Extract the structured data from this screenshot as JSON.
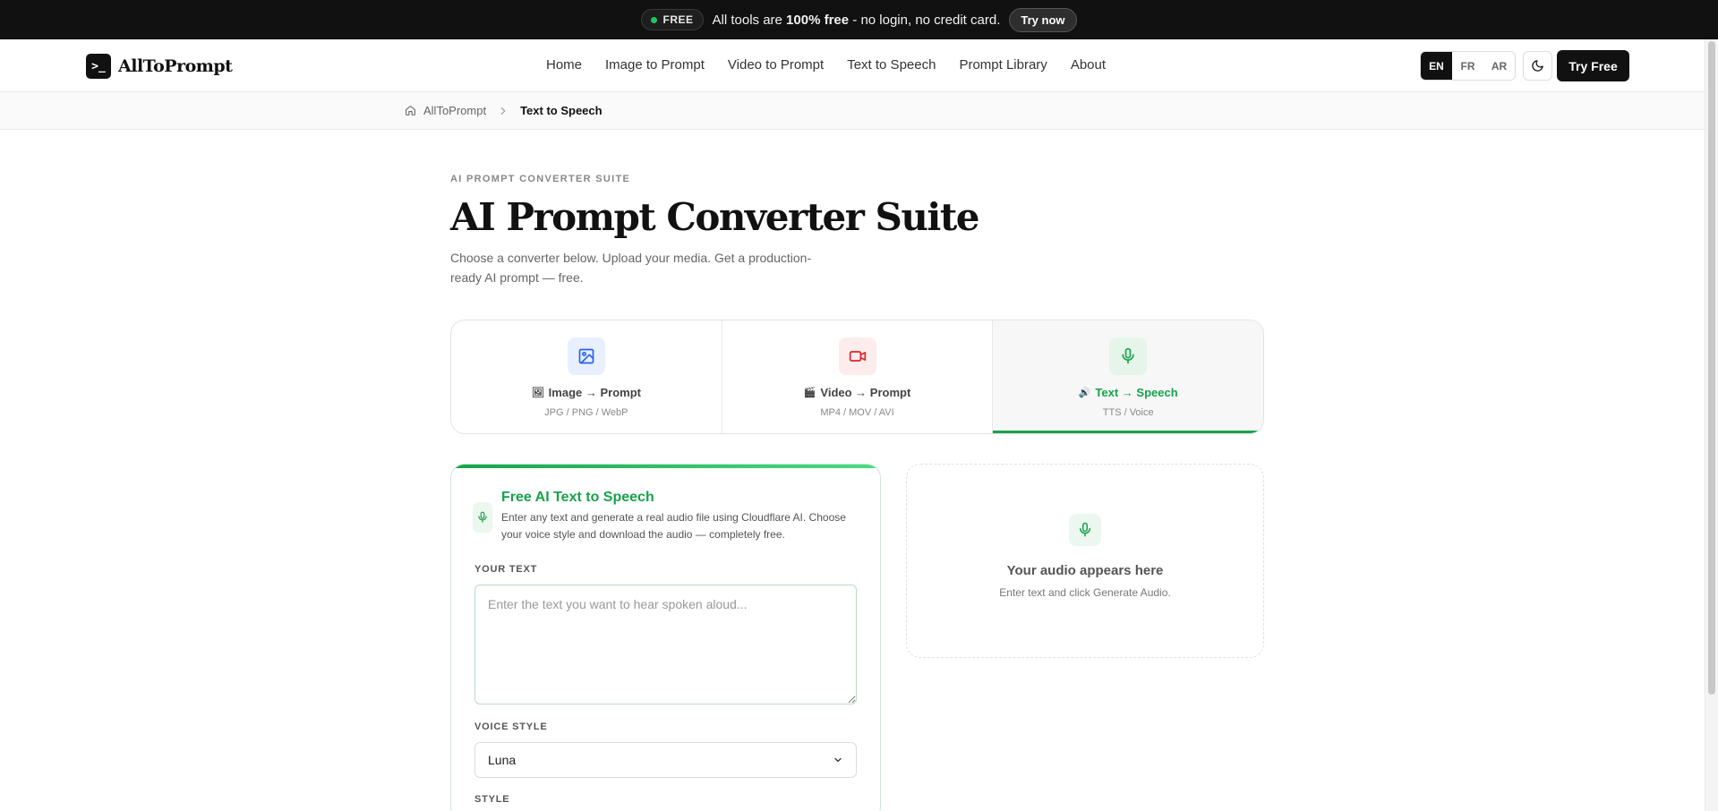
{
  "announcement": {
    "badge": "FREE",
    "text_prefix": "All tools are ",
    "text_bold": "100% free",
    "text_suffix": " - no login, no credit card.",
    "cta": "Try now"
  },
  "header": {
    "logo_mark": ">_",
    "logo_text": "AllToPrompt",
    "nav": [
      "Home",
      "Image to Prompt",
      "Video to Prompt",
      "Text to Speech",
      "Prompt Library",
      "About"
    ],
    "languages": [
      "EN",
      "FR",
      "AR"
    ],
    "active_language": "EN",
    "theme_icon": "moon-icon",
    "cta": "Try Free"
  },
  "breadcrumb": {
    "home": "AllToPrompt",
    "current": "Text to Speech"
  },
  "hero": {
    "eyebrow": "AI PROMPT CONVERTER SUITE",
    "title": "AI Prompt Converter Suite",
    "description": "Choose a converter below. Upload your media. Get a production-ready AI prompt — free."
  },
  "tabs": [
    {
      "glyph": "🖼",
      "label": "Image → Prompt",
      "sub": "JPG / PNG / WebP",
      "icon": "image-icon",
      "color": "#2563eb",
      "bg": "#e8efff"
    },
    {
      "glyph": "🎬",
      "label": "Video → Prompt",
      "sub": "MP4 / MOV / AVI",
      "icon": "video-icon",
      "color": "#dc2626",
      "bg": "#fdecec"
    },
    {
      "glyph": "🔊",
      "label": "Text → Speech",
      "sub": "TTS / Voice",
      "icon": "microphone-icon",
      "color": "#16a34a",
      "bg": "#e6f5ea"
    }
  ],
  "active_tab": 2,
  "form": {
    "title": "Free AI Text to Speech",
    "description": "Enter any text and generate a real audio file using Cloudflare AI. Choose your voice style and download the audio — completely free.",
    "text_label": "YOUR TEXT",
    "text_placeholder": "Enter the text you want to hear spoken aloud...",
    "text_value": "",
    "voice_label": "VOICE STYLE",
    "voice_value": "Luna",
    "style_label": "STYLE"
  },
  "output": {
    "title": "Your audio appears here",
    "subtitle": "Enter text and click Generate Audio."
  },
  "colors": {
    "accent": "#16a34a",
    "dark": "#111111"
  }
}
